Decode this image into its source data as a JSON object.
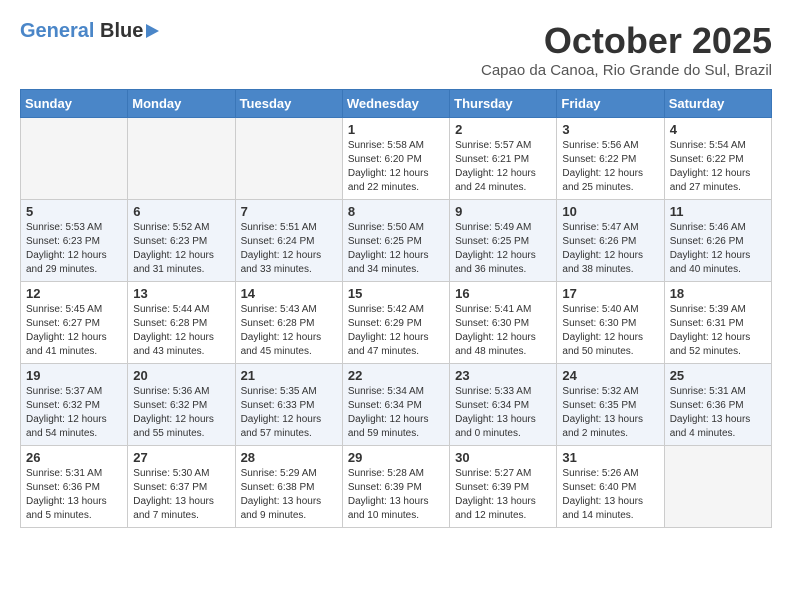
{
  "logo": {
    "line1": "General",
    "line2": "Blue"
  },
  "title": "October 2025",
  "location": "Capao da Canoa, Rio Grande do Sul, Brazil",
  "weekdays": [
    "Sunday",
    "Monday",
    "Tuesday",
    "Wednesday",
    "Thursday",
    "Friday",
    "Saturday"
  ],
  "weeks": [
    [
      {
        "day": "",
        "info": ""
      },
      {
        "day": "",
        "info": ""
      },
      {
        "day": "",
        "info": ""
      },
      {
        "day": "1",
        "info": "Sunrise: 5:58 AM\nSunset: 6:20 PM\nDaylight: 12 hours\nand 22 minutes."
      },
      {
        "day": "2",
        "info": "Sunrise: 5:57 AM\nSunset: 6:21 PM\nDaylight: 12 hours\nand 24 minutes."
      },
      {
        "day": "3",
        "info": "Sunrise: 5:56 AM\nSunset: 6:22 PM\nDaylight: 12 hours\nand 25 minutes."
      },
      {
        "day": "4",
        "info": "Sunrise: 5:54 AM\nSunset: 6:22 PM\nDaylight: 12 hours\nand 27 minutes."
      }
    ],
    [
      {
        "day": "5",
        "info": "Sunrise: 5:53 AM\nSunset: 6:23 PM\nDaylight: 12 hours\nand 29 minutes."
      },
      {
        "day": "6",
        "info": "Sunrise: 5:52 AM\nSunset: 6:23 PM\nDaylight: 12 hours\nand 31 minutes."
      },
      {
        "day": "7",
        "info": "Sunrise: 5:51 AM\nSunset: 6:24 PM\nDaylight: 12 hours\nand 33 minutes."
      },
      {
        "day": "8",
        "info": "Sunrise: 5:50 AM\nSunset: 6:25 PM\nDaylight: 12 hours\nand 34 minutes."
      },
      {
        "day": "9",
        "info": "Sunrise: 5:49 AM\nSunset: 6:25 PM\nDaylight: 12 hours\nand 36 minutes."
      },
      {
        "day": "10",
        "info": "Sunrise: 5:47 AM\nSunset: 6:26 PM\nDaylight: 12 hours\nand 38 minutes."
      },
      {
        "day": "11",
        "info": "Sunrise: 5:46 AM\nSunset: 6:26 PM\nDaylight: 12 hours\nand 40 minutes."
      }
    ],
    [
      {
        "day": "12",
        "info": "Sunrise: 5:45 AM\nSunset: 6:27 PM\nDaylight: 12 hours\nand 41 minutes."
      },
      {
        "day": "13",
        "info": "Sunrise: 5:44 AM\nSunset: 6:28 PM\nDaylight: 12 hours\nand 43 minutes."
      },
      {
        "day": "14",
        "info": "Sunrise: 5:43 AM\nSunset: 6:28 PM\nDaylight: 12 hours\nand 45 minutes."
      },
      {
        "day": "15",
        "info": "Sunrise: 5:42 AM\nSunset: 6:29 PM\nDaylight: 12 hours\nand 47 minutes."
      },
      {
        "day": "16",
        "info": "Sunrise: 5:41 AM\nSunset: 6:30 PM\nDaylight: 12 hours\nand 48 minutes."
      },
      {
        "day": "17",
        "info": "Sunrise: 5:40 AM\nSunset: 6:30 PM\nDaylight: 12 hours\nand 50 minutes."
      },
      {
        "day": "18",
        "info": "Sunrise: 5:39 AM\nSunset: 6:31 PM\nDaylight: 12 hours\nand 52 minutes."
      }
    ],
    [
      {
        "day": "19",
        "info": "Sunrise: 5:37 AM\nSunset: 6:32 PM\nDaylight: 12 hours\nand 54 minutes."
      },
      {
        "day": "20",
        "info": "Sunrise: 5:36 AM\nSunset: 6:32 PM\nDaylight: 12 hours\nand 55 minutes."
      },
      {
        "day": "21",
        "info": "Sunrise: 5:35 AM\nSunset: 6:33 PM\nDaylight: 12 hours\nand 57 minutes."
      },
      {
        "day": "22",
        "info": "Sunrise: 5:34 AM\nSunset: 6:34 PM\nDaylight: 12 hours\nand 59 minutes."
      },
      {
        "day": "23",
        "info": "Sunrise: 5:33 AM\nSunset: 6:34 PM\nDaylight: 13 hours\nand 0 minutes."
      },
      {
        "day": "24",
        "info": "Sunrise: 5:32 AM\nSunset: 6:35 PM\nDaylight: 13 hours\nand 2 minutes."
      },
      {
        "day": "25",
        "info": "Sunrise: 5:31 AM\nSunset: 6:36 PM\nDaylight: 13 hours\nand 4 minutes."
      }
    ],
    [
      {
        "day": "26",
        "info": "Sunrise: 5:31 AM\nSunset: 6:36 PM\nDaylight: 13 hours\nand 5 minutes."
      },
      {
        "day": "27",
        "info": "Sunrise: 5:30 AM\nSunset: 6:37 PM\nDaylight: 13 hours\nand 7 minutes."
      },
      {
        "day": "28",
        "info": "Sunrise: 5:29 AM\nSunset: 6:38 PM\nDaylight: 13 hours\nand 9 minutes."
      },
      {
        "day": "29",
        "info": "Sunrise: 5:28 AM\nSunset: 6:39 PM\nDaylight: 13 hours\nand 10 minutes."
      },
      {
        "day": "30",
        "info": "Sunrise: 5:27 AM\nSunset: 6:39 PM\nDaylight: 13 hours\nand 12 minutes."
      },
      {
        "day": "31",
        "info": "Sunrise: 5:26 AM\nSunset: 6:40 PM\nDaylight: 13 hours\nand 14 minutes."
      },
      {
        "day": "",
        "info": ""
      }
    ]
  ]
}
